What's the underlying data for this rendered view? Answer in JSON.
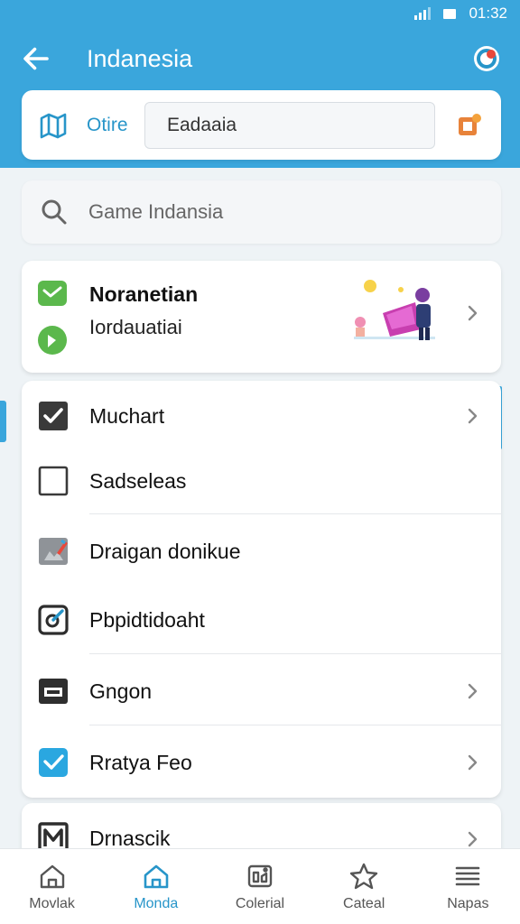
{
  "status_bar": {
    "time": "01:32"
  },
  "app_bar": {
    "title": "Indanesia"
  },
  "top_card": {
    "label": "Otire",
    "input_value": "Eadaaia"
  },
  "search": {
    "text": "Game Indansia"
  },
  "feature_card": {
    "title": "Noranetian",
    "subtitle": "Iordauatiai"
  },
  "list": {
    "items": [
      {
        "label": "Muchart",
        "icon": "checkbox-checked-icon",
        "chevron": true
      },
      {
        "label": "Sadseleas",
        "icon": "checkbox-empty-icon",
        "chevron": false
      },
      {
        "label": "Draigan donikue",
        "icon": "edit-image-icon",
        "chevron": false
      },
      {
        "label": "Pbpidtidoaht",
        "icon": "edit-square-icon",
        "chevron": false
      },
      {
        "label": "Gngon",
        "icon": "window-icon",
        "chevron": true
      },
      {
        "label": "Rratya Feo",
        "icon": "check-badge-icon",
        "chevron": true
      }
    ],
    "last_item": {
      "label": "Drnascik",
      "icon": "m-letter-icon",
      "chevron": true
    }
  },
  "bottom_nav": {
    "items": [
      {
        "label": "Movlak",
        "icon": "home-icon",
        "active": false
      },
      {
        "label": "Monda",
        "icon": "home-icon",
        "active": true
      },
      {
        "label": "Colerial",
        "icon": "photo-card-icon",
        "active": false
      },
      {
        "label": "Cateal",
        "icon": "star-icon",
        "active": false
      },
      {
        "label": "Napas",
        "icon": "menu-icon",
        "active": false
      }
    ]
  },
  "colors": {
    "accent": "#3aa6dc",
    "accent_dark": "#2795c9",
    "background": "#eef3f6"
  }
}
